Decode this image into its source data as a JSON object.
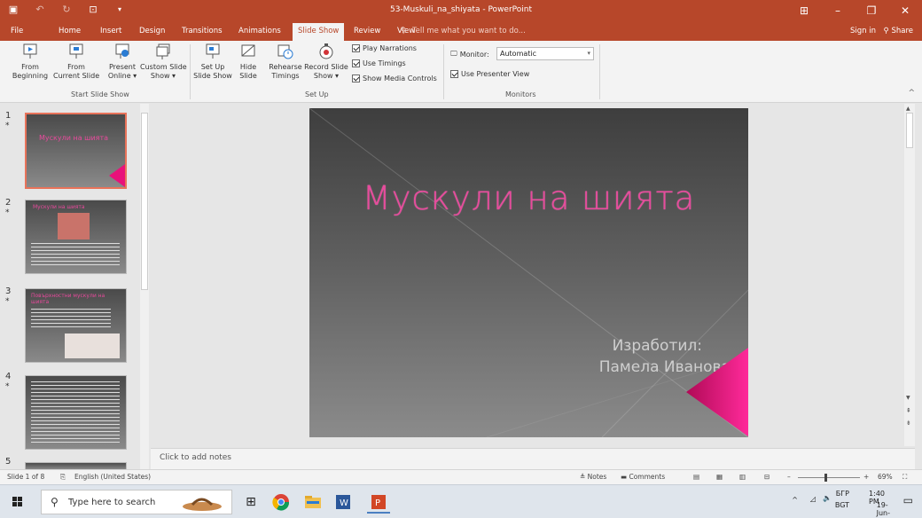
{
  "window": {
    "title": "53-Muskuli_na_shiyata - PowerPoint",
    "controls": [
      "minimize",
      "restore",
      "close"
    ]
  },
  "tabs": [
    "File",
    "Home",
    "Insert",
    "Design",
    "Transitions",
    "Animations",
    "Slide Show",
    "Review",
    "View"
  ],
  "active_tab": "Slide Show",
  "tell_me": "Tell me what you want to do...",
  "sign_in": "Sign in",
  "share": "Share",
  "ribbon": {
    "start_group": {
      "label": "Start Slide Show",
      "from_beginning": [
        "From",
        "Beginning"
      ],
      "from_current": [
        "From",
        "Current Slide"
      ],
      "present_online": [
        "Present",
        "Online ▾"
      ],
      "custom_show": [
        "Custom Slide",
        "Show ▾"
      ]
    },
    "setup_group": {
      "label": "Set Up",
      "setup_show": [
        "Set Up",
        "Slide Show"
      ],
      "hide_slide": [
        "Hide",
        "Slide"
      ],
      "rehearse": [
        "Rehearse",
        "Timings"
      ],
      "record": [
        "Record Slide",
        "Show ▾"
      ],
      "play_narrations": "Play Narrations",
      "use_timings": "Use Timings",
      "show_media_controls": "Show Media Controls"
    },
    "monitors_group": {
      "label": "Monitors",
      "monitor_label": "Monitor:",
      "monitor_value": "Automatic",
      "presenter_view": "Use Presenter View"
    }
  },
  "thumbnails": [
    {
      "num": "1",
      "star": "*",
      "title": "Мускули на шията"
    },
    {
      "num": "2",
      "star": "*",
      "title": "Мускули на шията"
    },
    {
      "num": "3",
      "star": "*",
      "title": "Повърхностни мускули на шията"
    },
    {
      "num": "4",
      "star": "*",
      "title": ""
    },
    {
      "num": "5",
      "star": "",
      "title": ""
    }
  ],
  "slide": {
    "title": "Мускули на шията",
    "author_label": "Изработил:",
    "author_name": "Памела Иванова"
  },
  "notes_placeholder": "Click to add notes",
  "status": {
    "slide_count": "Slide 1 of 8",
    "language": "English (United States)",
    "notes": "Notes",
    "comments": "Comments",
    "zoom": "69%"
  },
  "taskbar": {
    "search_placeholder": "Type here to search",
    "lang1": "БГР",
    "lang2": "BGT",
    "time": "1:40 PM",
    "date": "19-Jun-23"
  },
  "colors": {
    "accent": "#b7472a",
    "slide_title": "#e84a9c",
    "pink_corner": "#e8127a"
  }
}
